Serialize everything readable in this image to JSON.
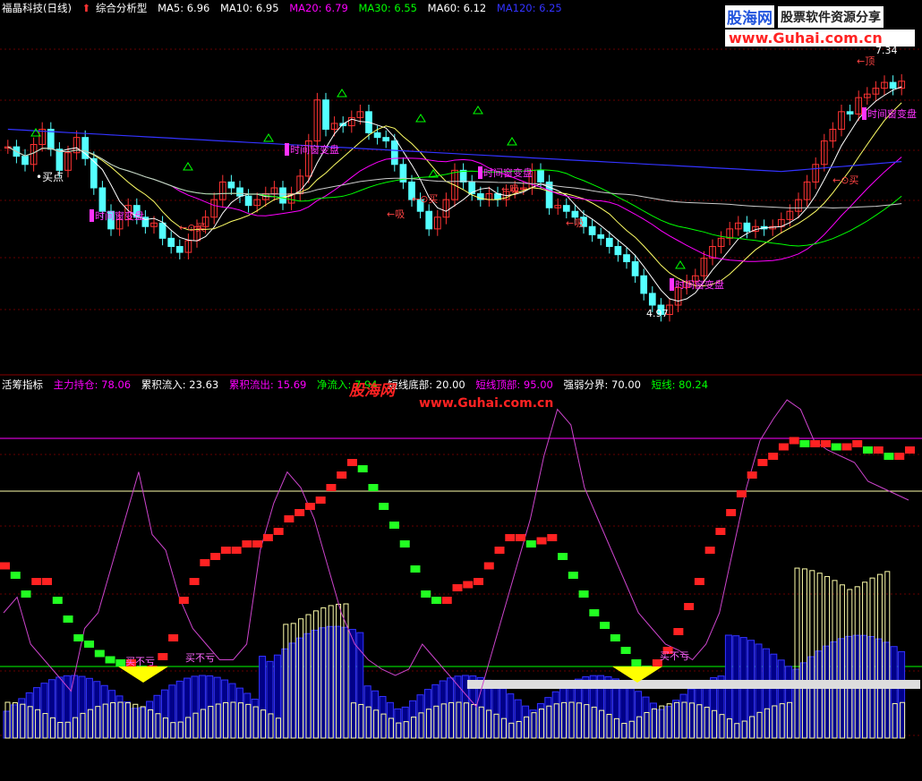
{
  "top": {
    "legend": [
      {
        "text": "福晶科技(日线)",
        "color": "#ffffff",
        "key": "title"
      },
      {
        "text": "综合分析型",
        "color": "#ffffff",
        "key": "indicator"
      },
      {
        "text": "MA5: 6.96",
        "color": "#ffffff",
        "key": "ma5"
      },
      {
        "text": "MA10: 6.95",
        "color": "#ffffff",
        "key": "ma10"
      },
      {
        "text": "MA20: 6.79",
        "color": "#ff00ff",
        "key": "ma20"
      },
      {
        "text": "MA30: 6.55",
        "color": "#00ff00",
        "key": "ma30"
      },
      {
        "text": "MA60: 6.12",
        "color": "#ffffff",
        "key": "ma60"
      },
      {
        "text": "MA120: 6.25",
        "color": "#3333ff",
        "key": "ma120"
      }
    ],
    "watermark": {
      "line1": "股海网",
      "line2": "股票软件资源分享",
      "url": "www.Guhai.com.cn"
    },
    "annotations": {
      "buy_point": "•买点",
      "buy": "←⊙买",
      "absorb": "←吸",
      "time_window": "时间窗变盘",
      "top": "←顶",
      "low_price": "4.97",
      "high_price": "7.34"
    }
  },
  "bottom": {
    "legend": [
      {
        "text": "活筹指标",
        "color": "#ffffff"
      },
      {
        "text": "主力持仓: 78.06",
        "color": "#ff00ff"
      },
      {
        "text": "累积流入: 23.63",
        "color": "#ffffff"
      },
      {
        "text": "累积流出: 15.69",
        "color": "#ff00ff"
      },
      {
        "text": "净流入: 7.94",
        "color": "#00ff00"
      },
      {
        "text": "短线底部: 20.00",
        "color": "#ffffff"
      },
      {
        "text": "短线顶部: 95.00",
        "color": "#ff00ff"
      },
      {
        "text": "强弱分界: 70.00",
        "color": "#ffffff"
      },
      {
        "text": "短线: 80.24",
        "color": "#00ff00"
      }
    ],
    "watermark": {
      "line1": "股海网",
      "url": "www.Guhai.com.cn"
    },
    "annotations": {
      "no_loss": "买不亏"
    }
  },
  "chart_data": {
    "type": "candlestick",
    "price": {
      "ylim": [
        4.6,
        7.5
      ],
      "close": [
        6.4,
        6.32,
        6.25,
        6.42,
        6.55,
        6.38,
        6.2,
        6.35,
        6.48,
        6.3,
        6.05,
        5.85,
        5.7,
        5.78,
        5.9,
        5.8,
        5.72,
        5.75,
        5.62,
        5.55,
        5.5,
        5.6,
        5.72,
        5.8,
        5.95,
        6.1,
        6.05,
        5.98,
        5.9,
        5.95,
        6.0,
        6.05,
        5.92,
        6.0,
        6.15,
        6.45,
        6.8,
        6.55,
        6.6,
        6.58,
        6.65,
        6.7,
        6.52,
        6.48,
        6.45,
        6.25,
        6.1,
        5.95,
        5.85,
        5.7,
        5.8,
        5.95,
        6.2,
        6.1,
        6.0,
        5.95,
        6.0,
        5.95,
        6.02,
        6.05,
        6.05,
        6.2,
        6.1,
        5.88,
        5.9,
        5.85,
        5.8,
        5.72,
        5.65,
        5.62,
        5.55,
        5.48,
        5.42,
        5.3,
        5.15,
        5.05,
        4.97,
        5.05,
        5.2,
        5.25,
        5.3,
        5.45,
        5.55,
        5.62,
        5.7,
        5.75,
        5.68,
        5.72,
        5.7,
        5.72,
        5.78,
        5.85,
        5.95,
        6.1,
        6.25,
        6.45,
        6.55,
        6.7,
        6.68,
        6.82,
        6.85,
        6.9,
        6.95,
        6.9,
        6.96
      ]
    },
    "moving_averages": {
      "MA5": 6.96,
      "MA10": 6.95,
      "MA20": 6.79,
      "MA30": 6.55,
      "MA60": 6.12,
      "MA120": 6.25
    },
    "indicator": {
      "ylim": [
        0,
        110
      ],
      "short_line": [
        55,
        52,
        46,
        50,
        50,
        44,
        38,
        32,
        30,
        27,
        25,
        24,
        24,
        22,
        22,
        26,
        32,
        44,
        50,
        56,
        58,
        60,
        60,
        62,
        62,
        64,
        66,
        70,
        72,
        74,
        76,
        80,
        84,
        88,
        86,
        80,
        74,
        68,
        62,
        54,
        46,
        44,
        44,
        48,
        49,
        50,
        55,
        60,
        64,
        64,
        62,
        63,
        64,
        58,
        52,
        46,
        40,
        36,
        32,
        28,
        24,
        22,
        24,
        28,
        34,
        42,
        50,
        60,
        66,
        72,
        78,
        84,
        88,
        90,
        93,
        95,
        94,
        94,
        94,
        93,
        93,
        94,
        92,
        92,
        90,
        90,
        92
      ],
      "main_position": [
        40,
        45,
        30,
        25,
        20,
        15,
        35,
        40,
        55,
        70,
        85,
        65,
        60,
        45,
        35,
        30,
        25,
        25,
        30,
        60,
        75,
        85,
        80,
        70,
        55,
        40,
        30,
        25,
        22,
        20,
        22,
        30,
        25,
        20,
        15,
        10,
        25,
        40,
        55,
        70,
        90,
        105,
        100,
        80,
        70,
        60,
        50,
        40,
        35,
        30,
        28,
        25,
        30,
        40,
        60,
        80,
        95,
        102,
        108,
        105,
        95,
        92,
        90,
        88,
        82,
        80,
        78,
        76
      ],
      "thresholds": {
        "short_bottom": 20,
        "strong_weak_boundary": 70,
        "short_top": 95
      }
    }
  }
}
